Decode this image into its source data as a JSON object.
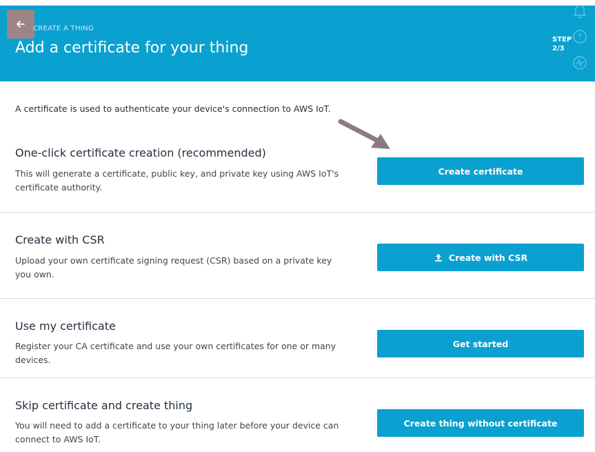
{
  "header": {
    "breadcrumb": "CREATE A THING",
    "title": "Add a certificate for your thing",
    "step_label": "STEP",
    "step_value": "2/3",
    "background_color": "#0aa1d0",
    "icons": [
      "back-arrow-icon",
      "bell-icon",
      "help-icon",
      "activity-icon"
    ]
  },
  "intro": "A certificate is used to authenticate your device's connection to AWS IoT.",
  "sections": [
    {
      "heading": "One-click certificate creation (recommended)",
      "desc_line1": "This will generate a certificate, public key, and private key using AWS IoT's",
      "desc_line2": "certificate authority.",
      "button": "Create certificate"
    },
    {
      "heading": "Create with CSR",
      "desc_line1": "Upload your own certificate signing request (CSR) based on a private key",
      "desc_line2": "you own.",
      "button": "Create with CSR",
      "button_icon": "upload-icon"
    },
    {
      "heading": "Use my certificate",
      "desc_line1": "Register your CA certificate and use your own certificates for one or many",
      "desc_line2": "devices.",
      "button": "Get started"
    },
    {
      "heading": "Skip certificate and create thing",
      "desc_line1": "You will need to add a certificate to your thing later before your device can",
      "desc_line2": "connect to AWS IoT.",
      "button": "Create thing without certificate"
    }
  ],
  "colors": {
    "accent": "#0aa1d0",
    "annotation_arrow": "#8c7b7d"
  }
}
